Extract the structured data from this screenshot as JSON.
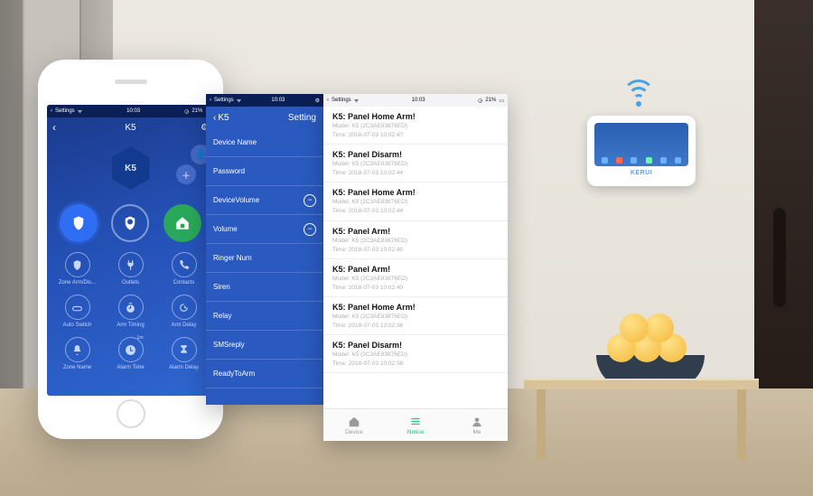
{
  "status": {
    "back": "Settings",
    "time": "10:03",
    "battery": "21%"
  },
  "panel_brand": "KERUI",
  "phone1": {
    "title": "K5",
    "hex_label": "K5",
    "big": [
      "arm-away-icon",
      "arm-stay-icon",
      "home-safe-icon"
    ],
    "grid": [
      {
        "label": "Zone Arm/Dis...",
        "icon": "shield"
      },
      {
        "label": "Outlets",
        "icon": "plug"
      },
      {
        "label": "Contacts",
        "icon": "phone"
      },
      {
        "label": "Auto Switch",
        "icon": "switch"
      },
      {
        "label": "Arm Timing",
        "icon": "timer"
      },
      {
        "label": "Arm Delay",
        "icon": "delay"
      },
      {
        "label": "Zone Name",
        "icon": "bell"
      },
      {
        "label": "Alarm Time",
        "icon": "clock",
        "badge": "1m"
      },
      {
        "label": "Alarm Delay",
        "icon": "hourglass"
      }
    ]
  },
  "settings": {
    "back_label": "K5",
    "title": "Setting",
    "rows": [
      {
        "label": "Device Name",
        "ctrl": null
      },
      {
        "label": "Password",
        "ctrl": null
      },
      {
        "label": "DeviceVolume",
        "ctrl": "minus"
      },
      {
        "label": "Volume",
        "ctrl": "minus"
      },
      {
        "label": "Ringer Num",
        "ctrl": null
      },
      {
        "label": "Siren",
        "ctrl": null
      },
      {
        "label": "Relay",
        "ctrl": null
      },
      {
        "label": "SMSreply",
        "ctrl": null
      },
      {
        "label": "ReadyToArm",
        "ctrl": null
      }
    ]
  },
  "notice": {
    "model_prefix": "Model:  K5 (2C3AE83876ED)",
    "time_prefix": "Time:  ",
    "items": [
      {
        "title": "K5: Panel Home Arm!",
        "time": "2018-07-03 10:02:47"
      },
      {
        "title": "K5: Panel Disarm!",
        "time": "2018-07-03 10:02:44"
      },
      {
        "title": "K5: Panel Home Arm!",
        "time": "2018-07-03 10:02:44"
      },
      {
        "title": "K5: Panel Arm!",
        "time": "2018-07-03 10:02:40"
      },
      {
        "title": "K5: Panel Arm!",
        "time": "2018-07-03 10:02:40"
      },
      {
        "title": "K5: Panel Home Arm!",
        "time": "2018-07-03 10:02:38"
      },
      {
        "title": "K5: Panel Disarm!",
        "time": "2018-07-03 10:02:38"
      }
    ],
    "tabs": {
      "device": "Device",
      "notice": "Notice",
      "me": "Me"
    }
  }
}
